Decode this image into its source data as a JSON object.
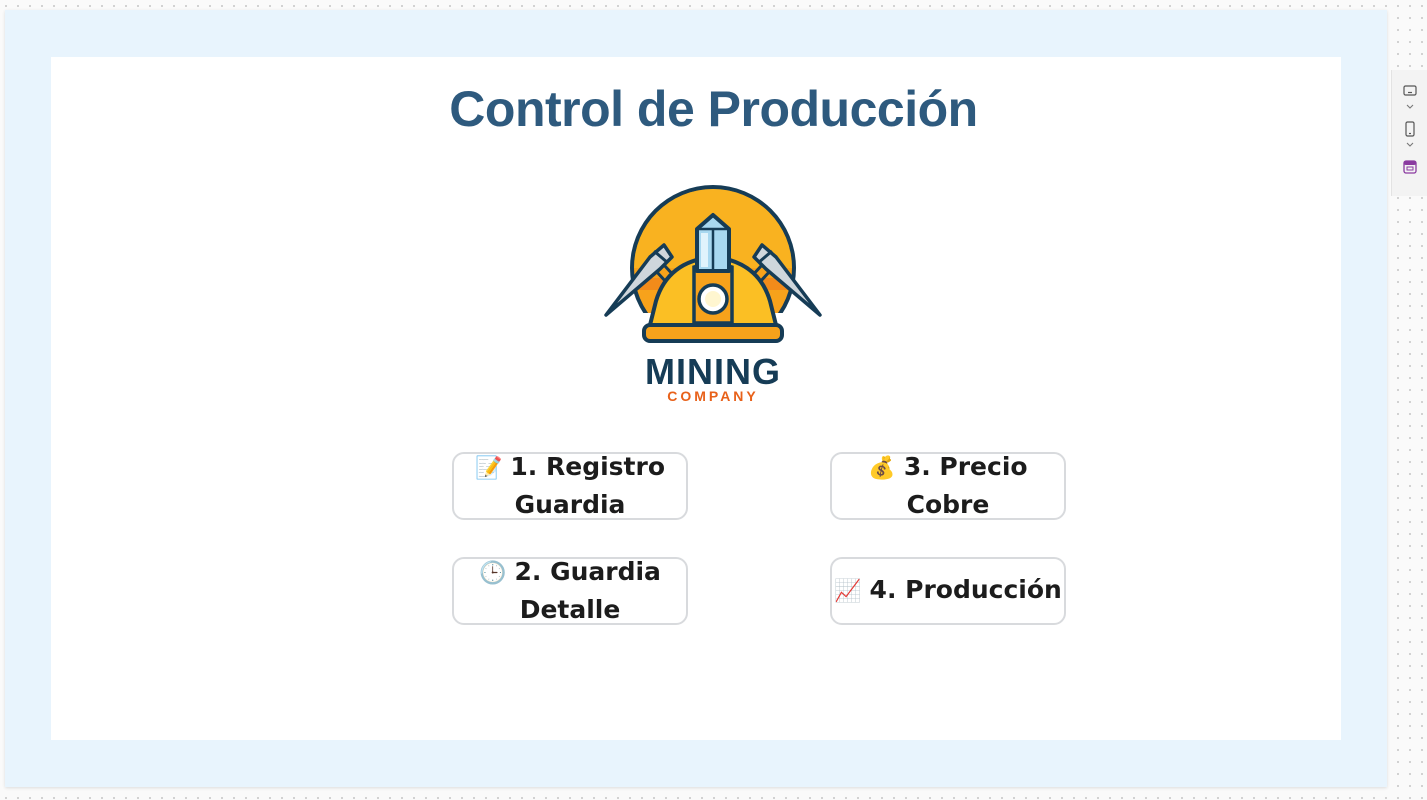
{
  "page": {
    "title": "Control de Producción"
  },
  "logo": {
    "brand_main": "MINING",
    "brand_sub": "COMPANY",
    "colors": {
      "navy": "#163c56",
      "orange": "#e8611a",
      "sun": "#f7a21b",
      "helmet": "#fbbf24",
      "crystal": "#a8d8f0"
    }
  },
  "buttons": [
    {
      "icon": "📝",
      "icon_name": "memo-icon",
      "label": "1. Registro Guardia"
    },
    {
      "icon": "🕒",
      "icon_name": "clock-icon",
      "label": "2. Guardia Detalle"
    },
    {
      "icon": "💰",
      "icon_name": "money-bag-icon",
      "label": "3. Precio Cobre"
    },
    {
      "icon": "📈",
      "icon_name": "chart-increasing-icon",
      "label": "4. Producción"
    }
  ],
  "toolbar": {
    "icons": [
      "desktop-view-icon",
      "chevron-down-icon",
      "phone-view-icon",
      "chevron-down-icon",
      "app-icon"
    ]
  },
  "colors": {
    "title": "#2e5a7e",
    "frame_background": "#e8f4fd",
    "button_border": "#d8dadd"
  }
}
